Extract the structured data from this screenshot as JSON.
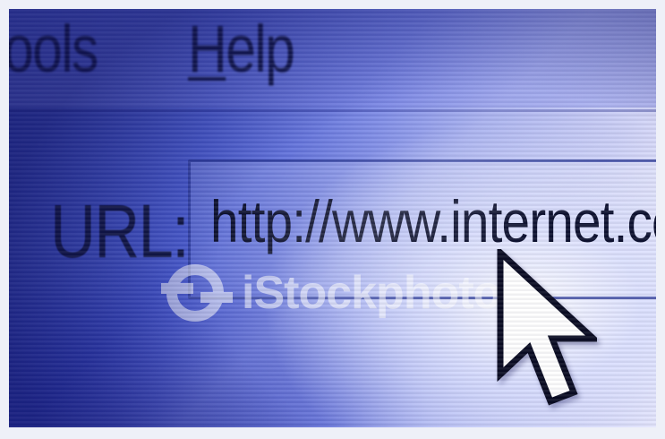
{
  "menubar": {
    "items": [
      {
        "label": "ools"
      },
      {
        "label_mnemonic": "H",
        "label_rest": "elp"
      }
    ]
  },
  "address_bar": {
    "label": "URL:",
    "value": "http://www.internet.com"
  },
  "watermark": {
    "text": "iStockphoto"
  },
  "icons": {
    "cursor": "mouse-pointer-arrow-icon",
    "watermark_logo": "istockphoto-logo-icon"
  },
  "colors": {
    "screen_blue": "#4a5cd0",
    "text_dark": "#121842",
    "highlight": "#ffffff"
  }
}
